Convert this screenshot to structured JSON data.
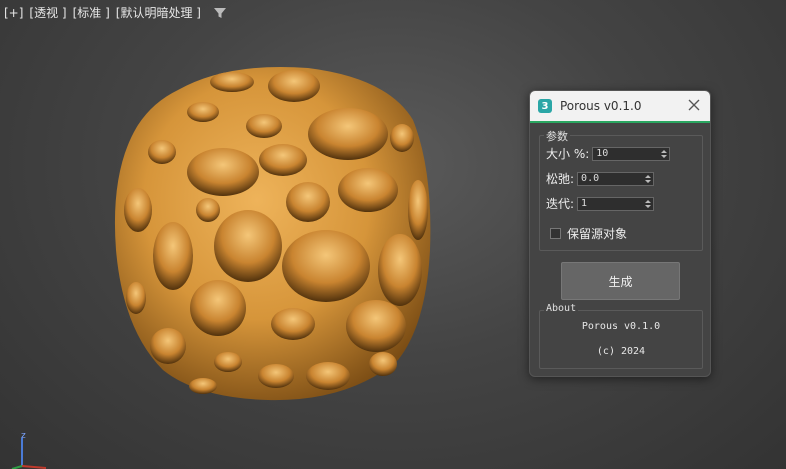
{
  "viewport": {
    "labels": [
      "[+]",
      "[透视 ]",
      "[标准 ]",
      "[默认明暗处理 ]"
    ],
    "filter_icon": "filter-icon",
    "gizmo_axis_label": "z",
    "object_color": "#d6953a"
  },
  "dialog": {
    "app_icon_text": "3",
    "title": "Porous v0.1.0",
    "accent_color": "#2aa660",
    "params": {
      "group_label": "参数",
      "size_label": "大小 %:",
      "size_value": "10",
      "relax_label": "松弛:",
      "relax_value": "0.0",
      "iter_label": "迭代:",
      "iter_value": "1",
      "keep_source_label": "保留源对象",
      "keep_source_checked": false
    },
    "generate_label": "生成",
    "about": {
      "group_label": "About",
      "line1": "Porous v0.1.0",
      "line2": "(c) 2024"
    }
  }
}
